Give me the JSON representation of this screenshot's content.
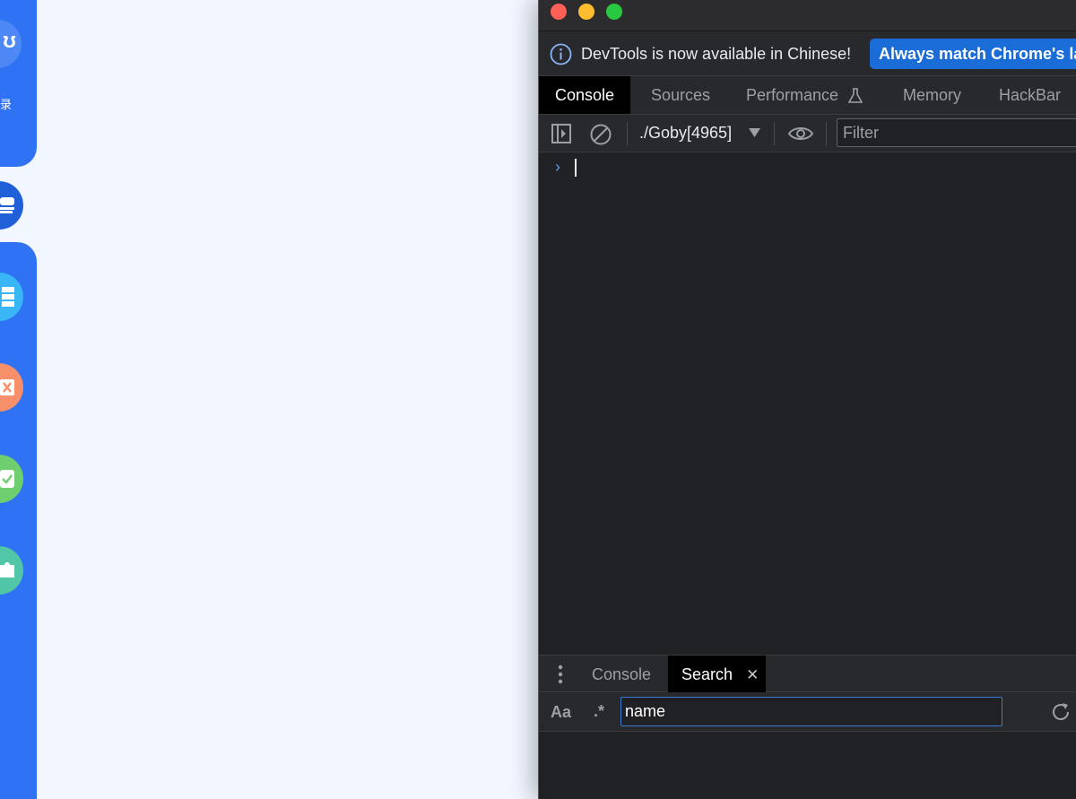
{
  "app_sidebar": {
    "label": "录",
    "colors": {
      "primary": "#2f73f4"
    },
    "icons": [
      "logo-icon",
      "scan-icon",
      "asset-icon",
      "vulnerability-icon",
      "report-icon",
      "extension-icon"
    ]
  },
  "devtools": {
    "infobar": {
      "message": "DevTools is now available in Chinese!",
      "button": "Always match Chrome's language"
    },
    "tabs": [
      {
        "label": "Console",
        "active": true
      },
      {
        "label": "Sources",
        "active": false
      },
      {
        "label": "Performance",
        "active": false
      },
      {
        "label": "Memory",
        "active": false
      },
      {
        "label": "HackBar",
        "active": false
      }
    ],
    "toolbar": {
      "context": "./Goby[4965]",
      "filter_placeholder": "Filter"
    },
    "console": {
      "prompt": "›"
    },
    "drawer": {
      "tabs": [
        {
          "label": "Console",
          "active": false
        },
        {
          "label": "Search",
          "active": true,
          "closable": true
        }
      ],
      "search": {
        "case_label": "Aa",
        "regex_label": ".*",
        "query": "name"
      }
    }
  }
}
